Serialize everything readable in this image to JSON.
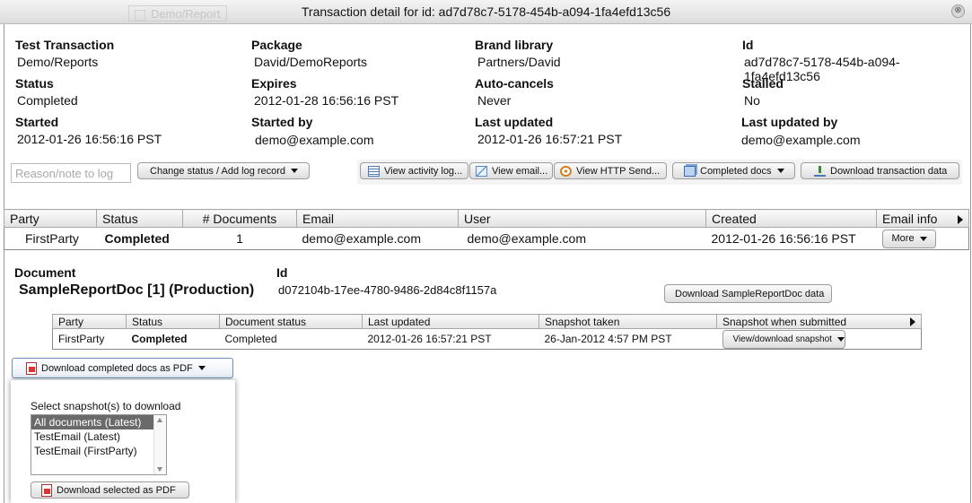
{
  "window": {
    "title": "Transaction detail for id: ad7d78c7-5178-454b-a094-1fa4efd13c56",
    "background_tab": "Demo/Report",
    "close_glyph": "⊗"
  },
  "summary": {
    "test_transaction": {
      "label": "Test Transaction",
      "value": "Demo/Reports"
    },
    "package": {
      "label": "Package",
      "value": "David/DemoReports"
    },
    "brand_library": {
      "label": "Brand library",
      "value": "Partners/David"
    },
    "id": {
      "label": "Id",
      "value": "ad7d78c7-5178-454b-a094-1fa4efd13c56"
    },
    "status": {
      "label": "Status",
      "value": "Completed"
    },
    "expires": {
      "label": "Expires",
      "value": "2012-01-28 16:56:16 PST"
    },
    "auto_cancels": {
      "label": "Auto-cancels",
      "value": "Never"
    },
    "stalled": {
      "label": "Stalled",
      "value": "No"
    },
    "started": {
      "label": "Started",
      "value": "2012-01-26 16:56:16 PST"
    },
    "started_by": {
      "label": "Started by",
      "value": "demo@example.com"
    },
    "last_updated": {
      "label": "Last updated",
      "value": "2012-01-26 16:57:21 PST"
    },
    "last_updated_by": {
      "label": "Last updated by",
      "value": "demo@example.com"
    }
  },
  "actions": {
    "reason_placeholder": "Reason/note to log",
    "change_status": "Change status / Add log record",
    "view_activity_log": "View activity log...",
    "view_email": "View email...",
    "view_http_send": "View HTTP Send...",
    "completed_docs": "Completed docs",
    "download_transaction_data": "Download transaction data"
  },
  "parties_table": {
    "headers": [
      "Party",
      "Status",
      "# Documents",
      "Email",
      "User",
      "Created",
      "Email info"
    ],
    "rows": [
      {
        "party": "FirstParty",
        "status": "Completed",
        "documents": "1",
        "email": "demo@example.com",
        "user": "demo@example.com",
        "created": "2012-01-26 16:56:16 PST",
        "more": "More"
      }
    ]
  },
  "document": {
    "label": "Document",
    "name": "SampleReportDoc [1] (Production)",
    "id_label": "Id",
    "id": "d072104b-17ee-4780-9486-2d84c8f1157a",
    "download_button": "Download SampleReportDoc data"
  },
  "document_table": {
    "headers": [
      "Party",
      "Status",
      "Document status",
      "Last updated",
      "Snapshot taken",
      "Snapshot when submitted"
    ],
    "rows": [
      {
        "party": "FirstParty",
        "status": "Completed",
        "doc_status": "Completed",
        "last_updated": "2012-01-26 16:57:21 PST",
        "snapshot_taken": "26-Jan-2012 4:57 PM PST",
        "snapshot_button": "View/download snapshot"
      }
    ]
  },
  "pdf_menu": {
    "button": "Download completed docs as PDF",
    "select_label": "Select snapshot(s) to download",
    "options": [
      "All documents (Latest)",
      "TestEmail (Latest)",
      "TestEmail (FirstParty)"
    ],
    "selected_index": 0,
    "download_selected": "Download selected as PDF"
  }
}
